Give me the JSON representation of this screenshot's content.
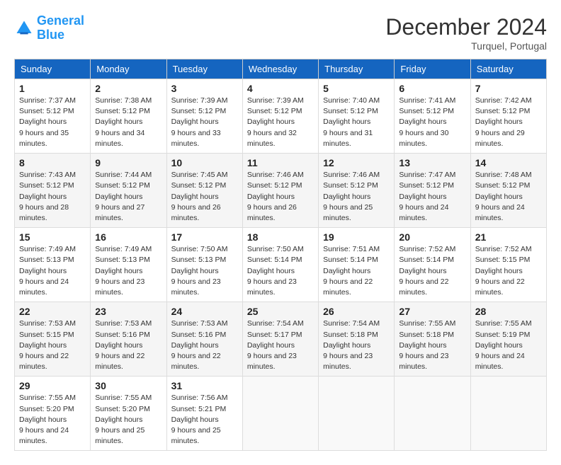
{
  "logo": {
    "line1": "General",
    "line2": "Blue"
  },
  "title": "December 2024",
  "location": "Turquel, Portugal",
  "days_of_week": [
    "Sunday",
    "Monday",
    "Tuesday",
    "Wednesday",
    "Thursday",
    "Friday",
    "Saturday"
  ],
  "weeks": [
    [
      {
        "day": "1",
        "sunrise": "7:37 AM",
        "sunset": "5:12 PM",
        "daylight": "9 hours and 35 minutes."
      },
      {
        "day": "2",
        "sunrise": "7:38 AM",
        "sunset": "5:12 PM",
        "daylight": "9 hours and 34 minutes."
      },
      {
        "day": "3",
        "sunrise": "7:39 AM",
        "sunset": "5:12 PM",
        "daylight": "9 hours and 33 minutes."
      },
      {
        "day": "4",
        "sunrise": "7:39 AM",
        "sunset": "5:12 PM",
        "daylight": "9 hours and 32 minutes."
      },
      {
        "day": "5",
        "sunrise": "7:40 AM",
        "sunset": "5:12 PM",
        "daylight": "9 hours and 31 minutes."
      },
      {
        "day": "6",
        "sunrise": "7:41 AM",
        "sunset": "5:12 PM",
        "daylight": "9 hours and 30 minutes."
      },
      {
        "day": "7",
        "sunrise": "7:42 AM",
        "sunset": "5:12 PM",
        "daylight": "9 hours and 29 minutes."
      }
    ],
    [
      {
        "day": "8",
        "sunrise": "7:43 AM",
        "sunset": "5:12 PM",
        "daylight": "9 hours and 28 minutes."
      },
      {
        "day": "9",
        "sunrise": "7:44 AM",
        "sunset": "5:12 PM",
        "daylight": "9 hours and 27 minutes."
      },
      {
        "day": "10",
        "sunrise": "7:45 AM",
        "sunset": "5:12 PM",
        "daylight": "9 hours and 26 minutes."
      },
      {
        "day": "11",
        "sunrise": "7:46 AM",
        "sunset": "5:12 PM",
        "daylight": "9 hours and 26 minutes."
      },
      {
        "day": "12",
        "sunrise": "7:46 AM",
        "sunset": "5:12 PM",
        "daylight": "9 hours and 25 minutes."
      },
      {
        "day": "13",
        "sunrise": "7:47 AM",
        "sunset": "5:12 PM",
        "daylight": "9 hours and 24 minutes."
      },
      {
        "day": "14",
        "sunrise": "7:48 AM",
        "sunset": "5:12 PM",
        "daylight": "9 hours and 24 minutes."
      }
    ],
    [
      {
        "day": "15",
        "sunrise": "7:49 AM",
        "sunset": "5:13 PM",
        "daylight": "9 hours and 24 minutes."
      },
      {
        "day": "16",
        "sunrise": "7:49 AM",
        "sunset": "5:13 PM",
        "daylight": "9 hours and 23 minutes."
      },
      {
        "day": "17",
        "sunrise": "7:50 AM",
        "sunset": "5:13 PM",
        "daylight": "9 hours and 23 minutes."
      },
      {
        "day": "18",
        "sunrise": "7:50 AM",
        "sunset": "5:14 PM",
        "daylight": "9 hours and 23 minutes."
      },
      {
        "day": "19",
        "sunrise": "7:51 AM",
        "sunset": "5:14 PM",
        "daylight": "9 hours and 22 minutes."
      },
      {
        "day": "20",
        "sunrise": "7:52 AM",
        "sunset": "5:14 PM",
        "daylight": "9 hours and 22 minutes."
      },
      {
        "day": "21",
        "sunrise": "7:52 AM",
        "sunset": "5:15 PM",
        "daylight": "9 hours and 22 minutes."
      }
    ],
    [
      {
        "day": "22",
        "sunrise": "7:53 AM",
        "sunset": "5:15 PM",
        "daylight": "9 hours and 22 minutes."
      },
      {
        "day": "23",
        "sunrise": "7:53 AM",
        "sunset": "5:16 PM",
        "daylight": "9 hours and 22 minutes."
      },
      {
        "day": "24",
        "sunrise": "7:53 AM",
        "sunset": "5:16 PM",
        "daylight": "9 hours and 22 minutes."
      },
      {
        "day": "25",
        "sunrise": "7:54 AM",
        "sunset": "5:17 PM",
        "daylight": "9 hours and 23 minutes."
      },
      {
        "day": "26",
        "sunrise": "7:54 AM",
        "sunset": "5:18 PM",
        "daylight": "9 hours and 23 minutes."
      },
      {
        "day": "27",
        "sunrise": "7:55 AM",
        "sunset": "5:18 PM",
        "daylight": "9 hours and 23 minutes."
      },
      {
        "day": "28",
        "sunrise": "7:55 AM",
        "sunset": "5:19 PM",
        "daylight": "9 hours and 24 minutes."
      }
    ],
    [
      {
        "day": "29",
        "sunrise": "7:55 AM",
        "sunset": "5:20 PM",
        "daylight": "9 hours and 24 minutes."
      },
      {
        "day": "30",
        "sunrise": "7:55 AM",
        "sunset": "5:20 PM",
        "daylight": "9 hours and 25 minutes."
      },
      {
        "day": "31",
        "sunrise": "7:56 AM",
        "sunset": "5:21 PM",
        "daylight": "9 hours and 25 minutes."
      },
      null,
      null,
      null,
      null
    ]
  ],
  "labels": {
    "sunrise": "Sunrise:",
    "sunset": "Sunset:",
    "daylight": "Daylight hours"
  }
}
